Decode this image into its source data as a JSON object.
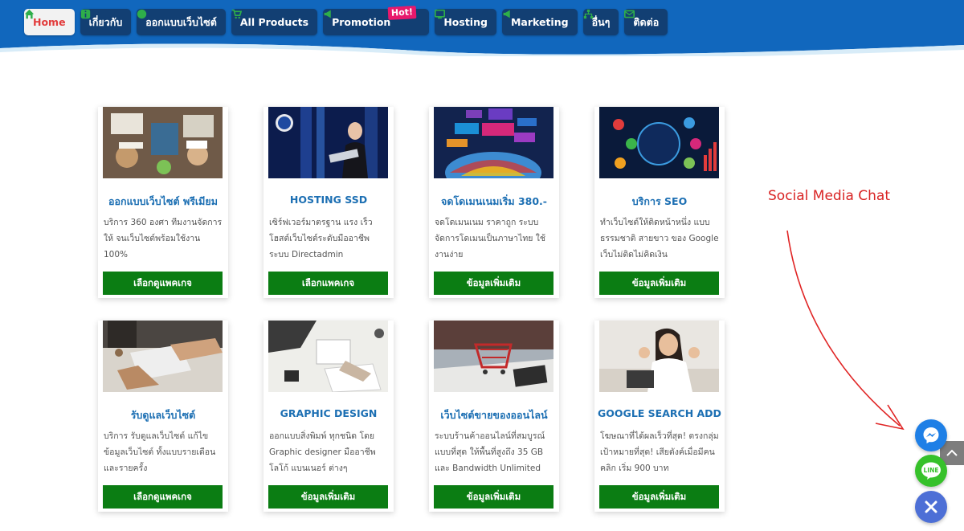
{
  "nav": {
    "items": [
      {
        "label": "Home",
        "icon": "home-icon"
      },
      {
        "label": "เกี่ยวกับ",
        "icon": "info-icon"
      },
      {
        "label": "ออกแบบเว็บไซต์",
        "icon": "globe-icon"
      },
      {
        "label": "All Products",
        "icon": "cart-icon"
      },
      {
        "label": "Promotion",
        "icon": "megaphone-icon",
        "badge": "Hot!"
      },
      {
        "label": "Hosting",
        "icon": "monitor-icon"
      },
      {
        "label": "Marketing",
        "icon": "megaphone-icon"
      },
      {
        "label": "อื่นๆ",
        "icon": "sitemap-icon"
      },
      {
        "label": "ติดต่อ",
        "icon": "envelope-icon"
      }
    ],
    "active_index": 0
  },
  "cards": [
    {
      "image": "team-meeting-photo",
      "title": "ออกแบบเว็บไซต์ พรีเมียม",
      "desc": "บริการ 360 องศา ทีมงานจัดการให้ จนเว็บไซต์พร้อมใช้งาน 100%",
      "button": "เลือกดูแพคเกจ"
    },
    {
      "image": "hosting-photo",
      "title": "HOSTING SSD",
      "desc": "เซิร์ฟเวอร์มาตรฐาน แรง เร็ว โฮสต์เว็บไซต์ระดับมืออาชีพ ระบบ Directadmin",
      "button": "เลือกแพคเกจ"
    },
    {
      "image": "domain-photo",
      "title": "จดโดเมนเนมเริ่ม 380.-",
      "desc": "จดโดเมนเนม ราคาถูก ระบบจัดการโดเมนเป็นภาษาไทย ใช้งานง่าย",
      "button": "ข้อมูลเพิ่มเติม"
    },
    {
      "image": "seo-photo",
      "title": "บริการ SEO",
      "desc": "ทำเว็บไซต์ให้ติดหน้าหนึ่ง แบบธรรมชาติ สายขาว ของ Google เว็บไม่ติดไม่คิดเงิน",
      "button": "ข้อมูลเพิ่มเติม"
    },
    {
      "image": "laptop-desk-photo",
      "title": "รับดูแลเว็บไซต์",
      "desc": "บริการ รับดูแลเว็บไซต์ แก้ไขข้อมูลเว็บไซต์ ทั้งแบบรายเดือนและรายครั้ง",
      "button": "เลือกดูแพคเกจ"
    },
    {
      "image": "designer-photo",
      "title": "GRAPHIC DESIGN",
      "desc": "ออกแบบสิ่งพิมพ์ ทุกชนิด โดย Graphic designer มืออาชีพ โลโก้ แบนเนอร์ ต่างๆ",
      "button": "ข้อมูลเพิ่มเติม"
    },
    {
      "image": "shopping-cart-photo",
      "title": "เว็บไซต์ขายของออนไลน์",
      "desc": "ระบบร้านค้าออนไลน์ที่สมบูรณ์แบบที่สุด ให้พื้นที่สูงถึง 35 GB และ Bandwidth Unlimited",
      "button": "ข้อมูลเพิ่มเติม"
    },
    {
      "image": "woman-laptop-photo",
      "title": "GOOGLE SEARCH ADD",
      "desc": "โฆษณาที่ได้ผลเร็วที่สุด! ตรงกลุ่มเป้าหมายที่สุด! เสียตังค์เมื่อมีคนคลิก เริ่ม 900 บาท",
      "button": "ข้อมูลเพิ่มเติม"
    }
  ],
  "annotation": {
    "label": "Social Media Chat"
  },
  "widgets": {
    "scroll_top_icon": "chevron-up-icon",
    "messenger_icon": "messenger-icon",
    "line_icon": "line-icon",
    "line_text": "LINE",
    "close_icon": "close-icon"
  },
  "colors": {
    "nav_blue": "#1167bd",
    "nav_item": "#123f73",
    "title_blue": "#1c6fb3",
    "button_green": "#0b7d13",
    "annotation_red": "#d92424"
  }
}
